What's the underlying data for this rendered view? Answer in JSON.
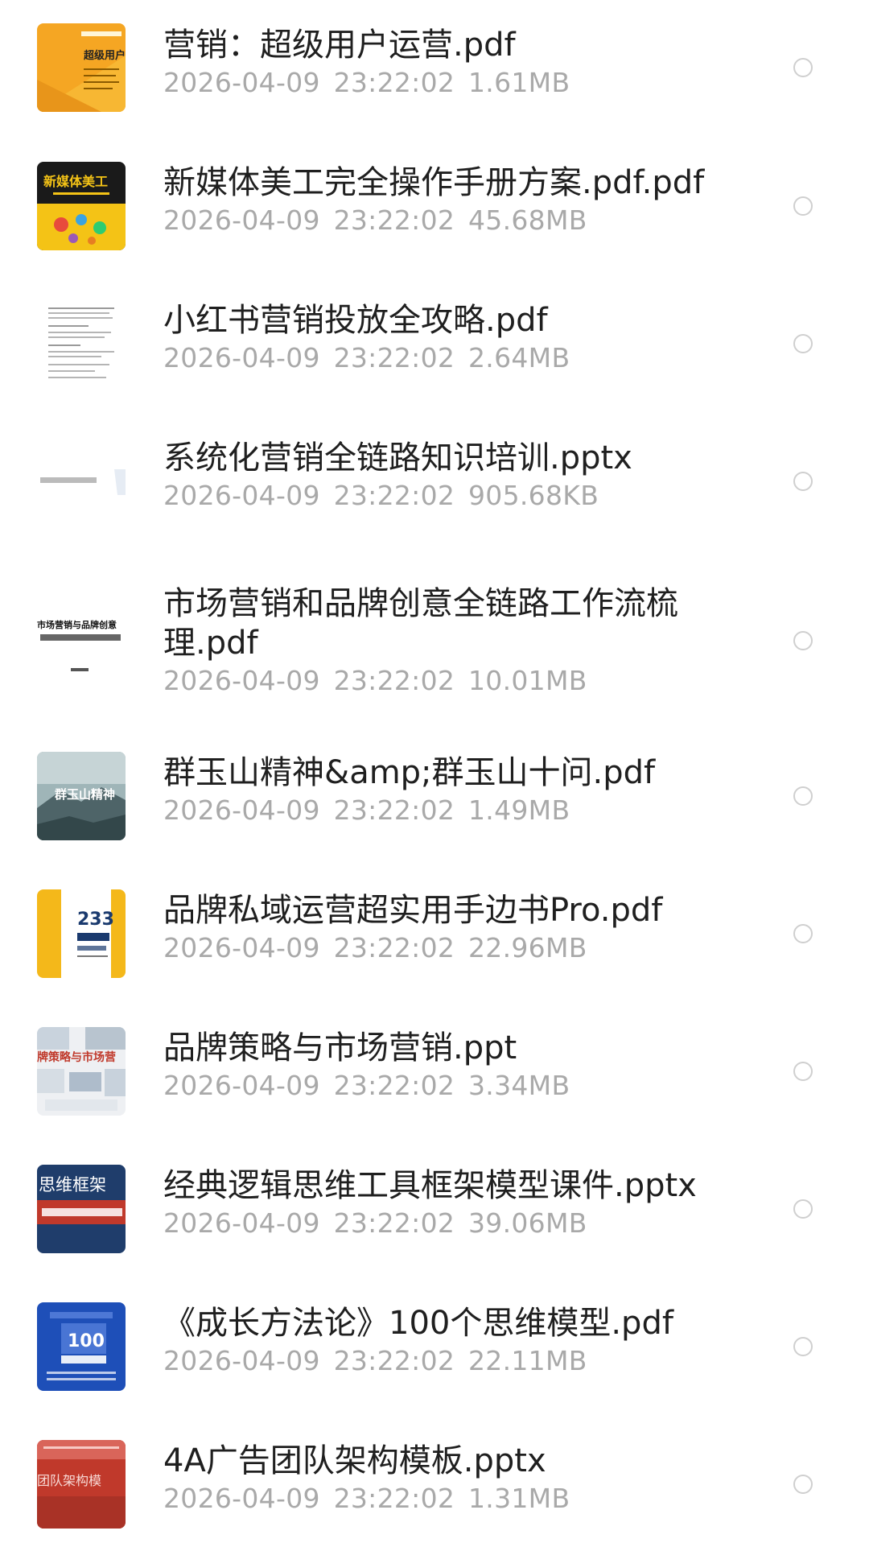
{
  "files": [
    {
      "name": "营销：超级用户运营.pdf",
      "date": "2026-04-09",
      "time": "23:22:02",
      "size": "1.61MB",
      "thumb_text": "超级用户运"
    },
    {
      "name": "新媒体美工完全操作手册方案.pdf.pdf",
      "date": "2026-04-09",
      "time": "23:22:02",
      "size": "45.68MB",
      "thumb_text": "新媒体美工"
    },
    {
      "name": "小红书营销投放全攻略.pdf",
      "date": "2026-04-09",
      "time": "23:22:02",
      "size": "2.64MB",
      "thumb_text": ""
    },
    {
      "name": "系统化营销全链路知识培训.pptx",
      "date": "2026-04-09",
      "time": "23:22:02",
      "size": "905.68KB",
      "thumb_text": ""
    },
    {
      "name": "市场营销和品牌创意全链路工作流梳理.pdf",
      "date": "2026-04-09",
      "time": "23:22:02",
      "size": "10.01MB",
      "thumb_text": "市场营销与品牌创意"
    },
    {
      "name": "群玉山精神&amp;群玉山十问.pdf",
      "date": "2026-04-09",
      "time": "23:22:02",
      "size": "1.49MB",
      "thumb_text": "群玉山精神"
    },
    {
      "name": "品牌私域运营超实用手边书Pro.pdf",
      "date": "2026-04-09",
      "time": "23:22:02",
      "size": "22.96MB",
      "thumb_text": "233"
    },
    {
      "name": "品牌策略与市场营销.ppt",
      "date": "2026-04-09",
      "time": "23:22:02",
      "size": "3.34MB",
      "thumb_text": "牌策略与市场营"
    },
    {
      "name": "经典逻辑思维工具框架模型课件.pptx",
      "date": "2026-04-09",
      "time": "23:22:02",
      "size": "39.06MB",
      "thumb_text": "思维框架"
    },
    {
      "name": "《成长方法论》100个思维模型.pdf",
      "date": "2026-04-09",
      "time": "23:22:02",
      "size": "22.11MB",
      "thumb_text": "100"
    },
    {
      "name": "4A广告团队架构模板.pptx",
      "date": "2026-04-09",
      "time": "23:22:02",
      "size": "1.31MB",
      "thumb_text": "团队架构模"
    }
  ],
  "colors": {
    "name_text": "#1f1f1f",
    "meta_text": "#a9a9a9",
    "radio_border": "#cfcfcf",
    "background": "#ffffff"
  }
}
